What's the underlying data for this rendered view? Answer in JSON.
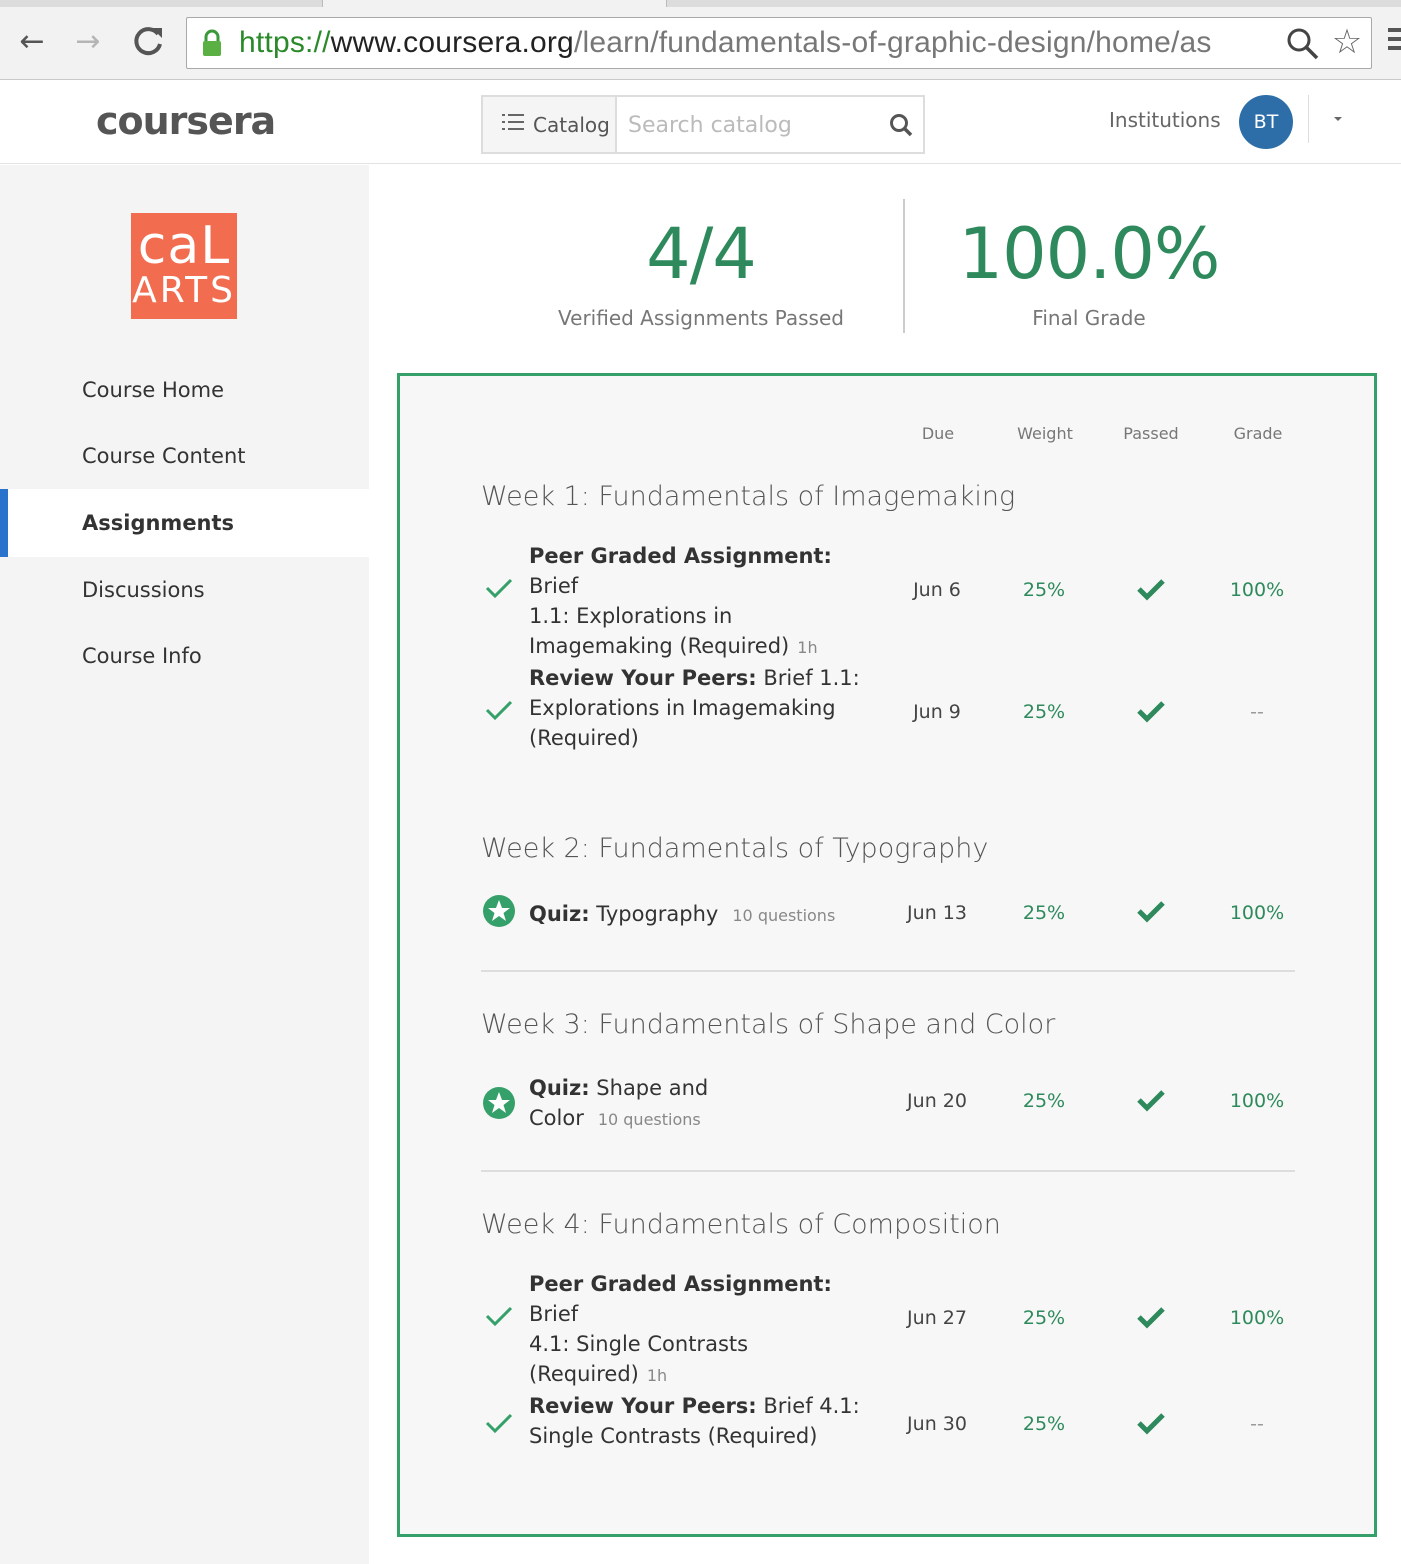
{
  "browser": {
    "url_scheme": "https://",
    "url_host": "www.coursera.org",
    "url_path": "/learn/fundamentals-of-graphic-design/home/as"
  },
  "header": {
    "logo": "coursera",
    "catalog_label": "Catalog",
    "search_placeholder": "Search catalog",
    "institutions": "Institutions",
    "avatar_initials": "BT"
  },
  "sidebar": {
    "logo_line1": "caL",
    "logo_line2": "ARTS",
    "items": [
      {
        "label": "Course Home",
        "active": false
      },
      {
        "label": "Course Content",
        "active": false
      },
      {
        "label": "Assignments",
        "active": true
      },
      {
        "label": "Discussions",
        "active": false
      },
      {
        "label": "Course Info",
        "active": false
      }
    ]
  },
  "summary": {
    "passed_value": "4/4",
    "passed_label": "Verified Assignments Passed",
    "grade_value": "100.0%",
    "grade_label": "Final Grade"
  },
  "table": {
    "columns": {
      "due": "Due",
      "weight": "Weight",
      "passed": "Passed",
      "grade": "Grade"
    },
    "weeks": [
      {
        "title": "Week 1: Fundamentals of Imagemaking",
        "items": [
          {
            "type_label": "Peer Graded Assignment:",
            "title_line1_rest": " Brief",
            "title_rest": "1.1: Explorations in Imagemaking (Required)",
            "meta": "1h",
            "due": "Jun 6",
            "weight": "25%",
            "grade": "100%"
          },
          {
            "type_label": "Review Your Peers:",
            "title_line1_rest": " Brief 1.1:",
            "title_rest": "Explorations in Imagemaking (Required)",
            "meta": "",
            "due": "Jun 9",
            "weight": "25%",
            "grade": "--"
          }
        ]
      },
      {
        "title": "Week 2: Fundamentals of Typography",
        "items": [
          {
            "type_label": "Quiz:",
            "title_line1_rest": " Typography",
            "title_rest": "",
            "meta": "10 questions",
            "due": "Jun 13",
            "weight": "25%",
            "grade": "100%"
          }
        ]
      },
      {
        "title": "Week 3: Fundamentals of Shape and Color",
        "items": [
          {
            "type_label": "Quiz:",
            "title_line1_rest": " Shape and",
            "title_rest": "Color",
            "meta": "10 questions",
            "due": "Jun 20",
            "weight": "25%",
            "grade": "100%"
          }
        ]
      },
      {
        "title": "Week 4: Fundamentals of Composition",
        "items": [
          {
            "type_label": "Peer Graded Assignment:",
            "title_line1_rest": " Brief",
            "title_rest": "4.1: Single Contrasts (Required)",
            "meta": "1h",
            "due": "Jun 27",
            "weight": "25%",
            "grade": "100%"
          },
          {
            "type_label": "Review Your Peers:",
            "title_line1_rest": " Brief 4.1:",
            "title_rest": "Single Contrasts (Required)",
            "meta": "",
            "due": "Jun 30",
            "weight": "25%",
            "grade": "--"
          }
        ]
      }
    ]
  },
  "colors": {
    "accent_green": "#2e8a5c",
    "panel_border": "#35a06a",
    "active_nav": "#2a73cc",
    "calarts_orange": "#f26c4f",
    "avatar_blue": "#2d6ea8"
  }
}
